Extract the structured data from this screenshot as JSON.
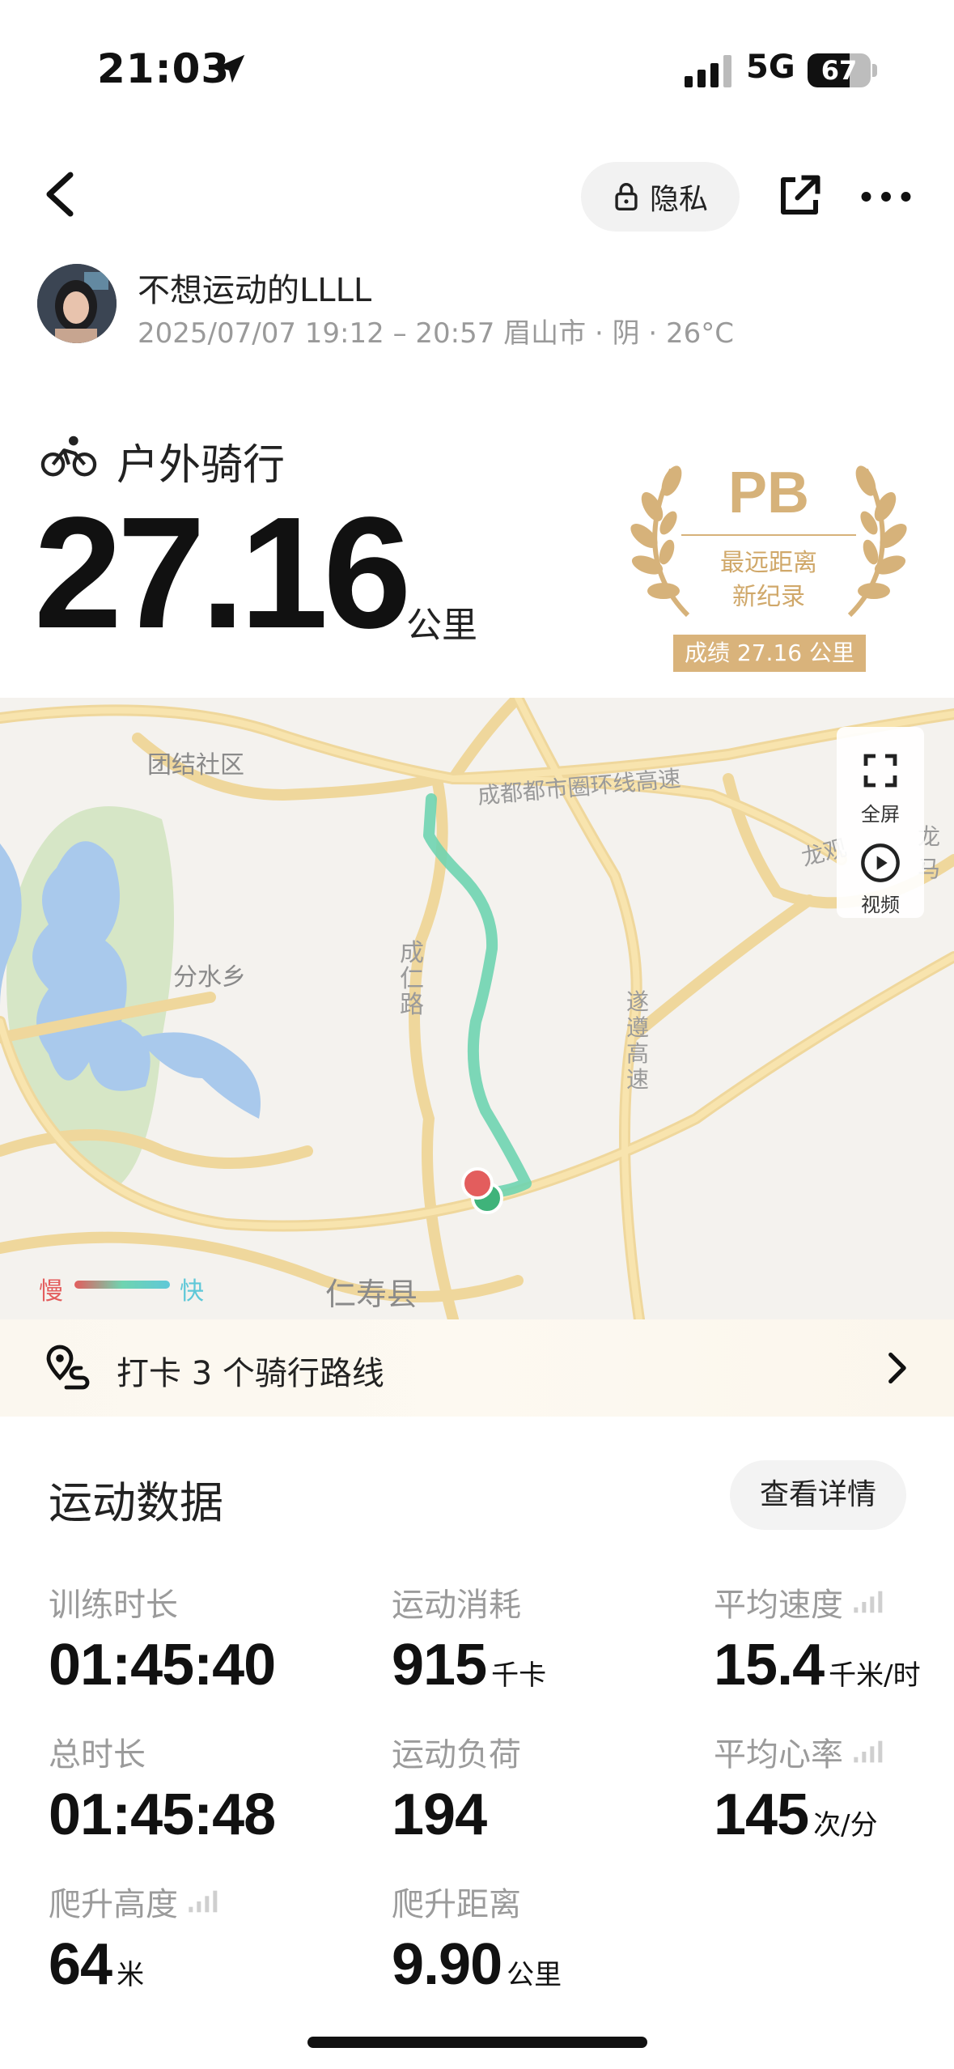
{
  "status_bar": {
    "time": "21:03",
    "network": "5G",
    "battery": "67",
    "battery_level": 0.67
  },
  "nav": {
    "privacy_label": "隐私"
  },
  "user": {
    "name": "不想运动的LLLL",
    "meta": "2025/07/07 19:12 – 20:57 眉山市 · 阴 · 26°C"
  },
  "activity": {
    "type": "户外骑行",
    "distance": "27.16",
    "distance_unit": "公里"
  },
  "pb_badge": {
    "title": "PB",
    "line1": "最远距离",
    "line2": "新纪录",
    "result": "成绩 27.16 公里",
    "color": "#d6b27a"
  },
  "map": {
    "labels": {
      "tuanjie": "团结社区",
      "ring_expressway": "成都都市圈环线高速",
      "fenshui": "分水乡",
      "chengren": "成仁路",
      "suizun": "遂遵高速",
      "longguang": "龙观",
      "renshou": "仁寿县",
      "long_side": "龙马"
    },
    "controls": {
      "fullscreen": "全屏",
      "video": "视频"
    },
    "legend": {
      "slow": "慢",
      "fast": "快"
    },
    "route_color": "#6fd4b0",
    "start_color": "#e35d5d",
    "end_color": "#3fb37a"
  },
  "checkin": {
    "text": "打卡 3 个骑行路线"
  },
  "stats": {
    "title": "运动数据",
    "detail_button": "查看详情",
    "items": [
      {
        "label": "训练时长",
        "value": "01:45:40",
        "unit": ""
      },
      {
        "label": "运动消耗",
        "value": "915",
        "unit": "千卡"
      },
      {
        "label": "平均速度",
        "value": "15.4",
        "unit": "千米/时"
      },
      {
        "label": "总时长",
        "value": "01:45:48",
        "unit": ""
      },
      {
        "label": "运动负荷",
        "value": "194",
        "unit": ""
      },
      {
        "label": "平均心率",
        "value": "145",
        "unit": "次/分"
      },
      {
        "label": "爬升高度",
        "value": "64",
        "unit": "米"
      },
      {
        "label": "爬升距离",
        "value": "9.90",
        "unit": "公里"
      }
    ]
  }
}
